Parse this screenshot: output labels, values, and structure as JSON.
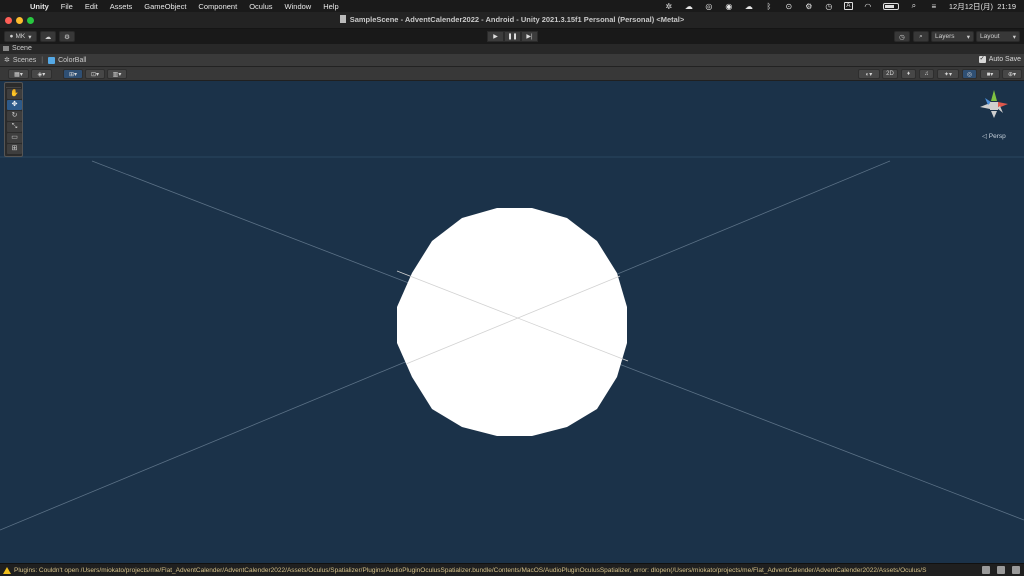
{
  "menubar": {
    "app_name": "Unity",
    "items": [
      "File",
      "Edit",
      "Assets",
      "GameObject",
      "Component",
      "Oculus",
      "Window",
      "Help"
    ],
    "clock": "12月12日(月)  21:19",
    "input_source": "A"
  },
  "window": {
    "title": "SampleScene - AdventCalender2022 - Android - Unity 2021.3.15f1 Personal (Personal) <Metal>"
  },
  "toolbar": {
    "account_label": "MK",
    "layers_label": "Layers",
    "layout_label": "Layout"
  },
  "scene_tab": {
    "label": "Scene"
  },
  "breadcrumb": {
    "root": "Scenes",
    "current": "ColorBall",
    "auto_save_label": "Auto Save"
  },
  "scene_toolbar": {
    "mode_2d": "2D"
  },
  "viewport": {
    "projection_label": "◁ Persp",
    "background_color": "#1b3249",
    "object": "white sphere"
  },
  "status": {
    "message": "Plugins: Couldn't open /Users/miokato/projects/me/Flat_AdventCalender/AdventCalender2022/Assets/Oculus/Spatializer/Plugins/AudioPluginOculusSpatializer.bundle/Contents/MacOS/AudioPluginOculusSpatializer, error: dlopen(/Users/miokato/projects/me/Flat_AdventCalender/AdventCalender2022/Assets/Oculus/S"
  }
}
